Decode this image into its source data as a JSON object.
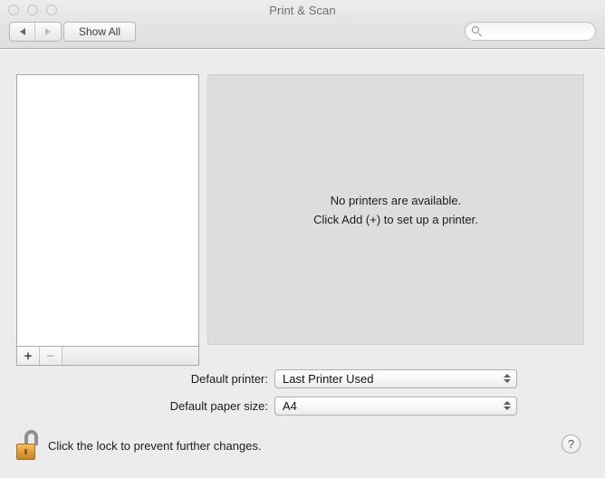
{
  "window": {
    "title": "Print & Scan",
    "traffic_lights": [
      "close",
      "minimize",
      "zoom"
    ]
  },
  "toolbar": {
    "back_label": "◀",
    "forward_label": "▶",
    "show_all_label": "Show All",
    "search": {
      "value": "",
      "placeholder": "",
      "icon": "search-icon"
    }
  },
  "printer_list": {
    "items": [],
    "add_label": "+",
    "remove_label": "−"
  },
  "detail": {
    "empty_line1": "No printers are available.",
    "empty_line2": "Click Add (+) to set up a printer."
  },
  "preferences": {
    "default_printer": {
      "label": "Default printer:",
      "value": "Last Printer Used"
    },
    "default_paper_size": {
      "label": "Default paper size:",
      "value": "A4"
    }
  },
  "lock": {
    "text": "Click the lock to prevent further changes.",
    "state": "unlocked",
    "icon": "unlocked-padlock-icon"
  },
  "help": {
    "label": "?"
  },
  "colors": {
    "window_bg": "#ececec",
    "panel_bg": "#dddddd",
    "list_bg": "#ffffff",
    "text": "#1c1c1c",
    "title_text": "#6e6e6e",
    "lock_gold": "#e0a23f"
  }
}
